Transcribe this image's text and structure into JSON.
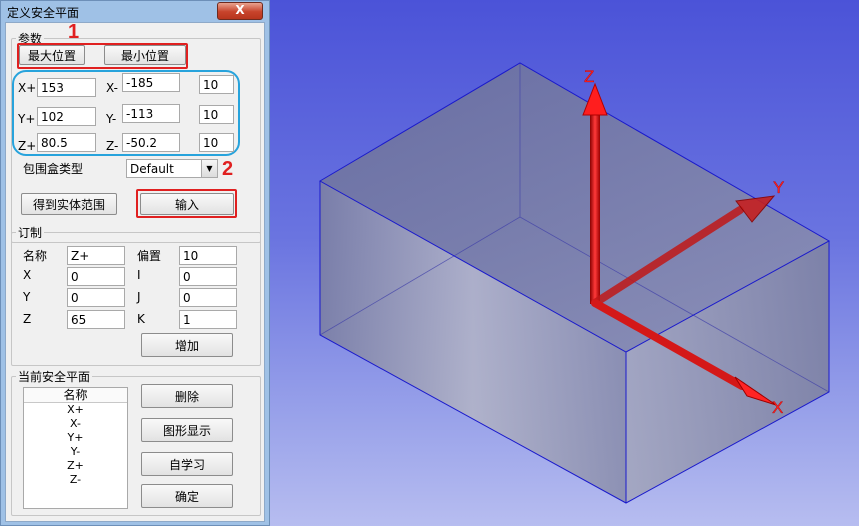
{
  "dialog": {
    "title": "定义安全平面",
    "close_label": "X"
  },
  "params": {
    "legend": "参数",
    "max_pos_label": "最大位置",
    "min_pos_label": "最小位置",
    "x_plus_label": "X+",
    "x_plus_value": "153",
    "x_minus_label": "X-",
    "x_minus_value": "-185",
    "x_offset": "10",
    "y_plus_label": "Y+",
    "y_plus_value": "102",
    "y_minus_label": "Y-",
    "y_minus_value": "-113",
    "y_offset": "10",
    "z_plus_label": "Z+",
    "z_plus_value": "80.5",
    "z_minus_label": "Z-",
    "z_minus_value": "-50.2",
    "z_offset": "10",
    "bbox_type_label": "包围盒类型",
    "bbox_type_value": "Default",
    "get_entity_label": "得到实体范围",
    "input_label": "输入"
  },
  "custom": {
    "legend": "订制",
    "name_label": "名称",
    "name_value": "Z+",
    "offset_label": "偏置",
    "offset_value": "10",
    "x_label": "X",
    "x_value": "0",
    "i_label": "I",
    "i_value": "0",
    "y_label": "Y",
    "y_value": "0",
    "j_label": "J",
    "j_value": "0",
    "z_label": "Z",
    "z_value": "65",
    "k_label": "K",
    "k_value": "1",
    "add_label": "增加"
  },
  "current": {
    "legend": "当前安全平面",
    "list_header": "名称",
    "items": [
      "X+",
      "X-",
      "Y+",
      "Y-",
      "Z+",
      "Z-"
    ],
    "delete_label": "删除",
    "graphic_label": "图形显示",
    "learn_label": "自学习",
    "ok_label": "确定"
  },
  "annotations": {
    "n1": "1",
    "n2": "2"
  },
  "viewport": {
    "axis_z": "Z",
    "axis_y": "Y",
    "axis_x": "X",
    "axis_color": "#e81818",
    "box_edge_color": "#1a1acc"
  }
}
